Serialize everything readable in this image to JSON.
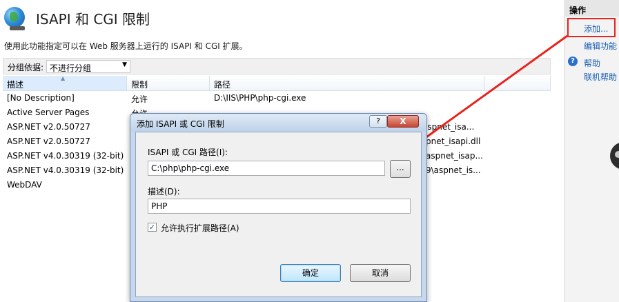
{
  "main": {
    "title": "ISAPI 和 CGI 限制",
    "description": "使用此功能指定可以在 Web 服务器上运行的 ISAPI 和 CGI 扩展。",
    "group_by_label": "分组依据:",
    "group_by_value": "不进行分组",
    "columns": [
      "描述",
      "限制",
      "路径"
    ],
    "rows": [
      {
        "description": "[No Description]",
        "restriction": "允许",
        "path": "D:\\IIS\\PHP\\php-cgi.exe"
      },
      {
        "description": "Active Server Pages",
        "restriction": "允许",
        "path": ""
      },
      {
        "description": "ASP.NET v2.0.50727",
        "restriction": "",
        "path": "aspnet_isa..."
      },
      {
        "description": "ASP.NET v2.0.50727",
        "restriction": "",
        "path": "pnet_isapi.dll"
      },
      {
        "description": "ASP.NET v4.0.30319 (32-bit)",
        "restriction": "",
        "path": "aspnet_isap..."
      },
      {
        "description": "ASP.NET v4.0.30319 (32-bit)",
        "restriction": "",
        "path": "9\\aspnet_is..."
      },
      {
        "description": "WebDAV",
        "restriction": "",
        "path": ""
      }
    ]
  },
  "actions": {
    "header": "操作",
    "add": "添加...",
    "edit_settings": "编辑功能",
    "help": "帮助",
    "online_help": "联机帮助"
  },
  "dialog": {
    "title": "添加 ISAPI 或 CGI 限制",
    "help_btn": "?",
    "close_btn": "X",
    "path_label": "ISAPI 或 CGI 路径(I):",
    "path_value": "C:\\php\\php-cgi.exe",
    "browse_btn": "...",
    "desc_label": "描述(D):",
    "desc_value": "PHP",
    "allow_checkbox_label": "允许执行扩展路径(A)",
    "allow_checked": true,
    "ok_btn": "确定",
    "cancel_btn": "取消"
  },
  "colors": {
    "highlight": "#e8221c",
    "arrow": "#e8221c",
    "link": "#1a5fb4"
  }
}
